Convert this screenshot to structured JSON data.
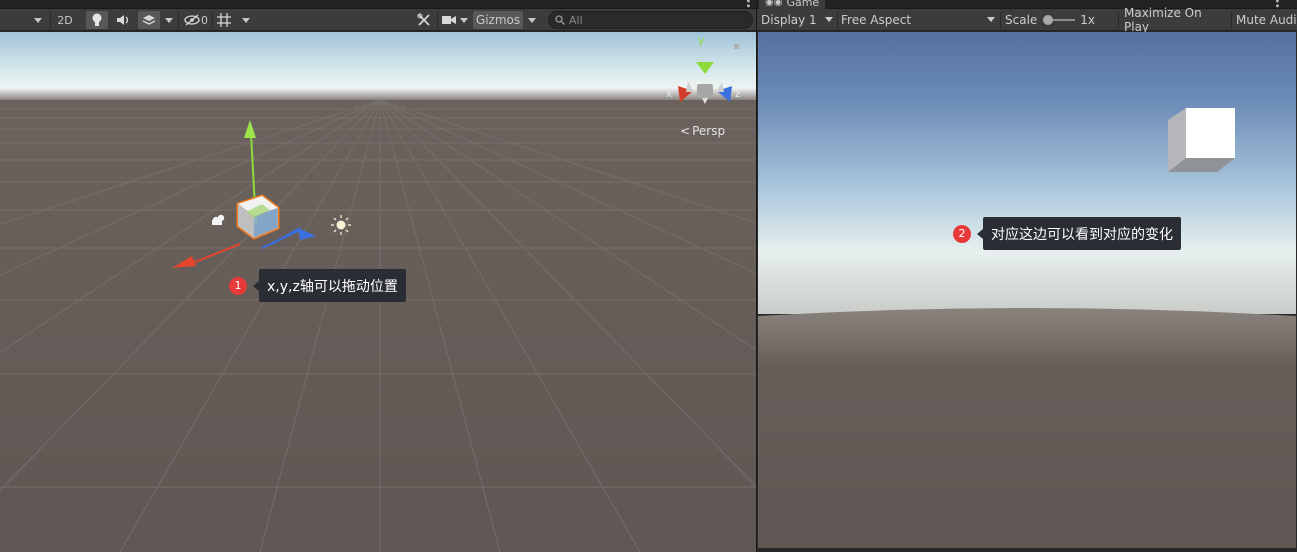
{
  "scene": {
    "toolbar": {
      "mode_2d": "2D",
      "hidden_count": "0",
      "gizmos": "Gizmos",
      "search_placeholder": "All"
    },
    "gizmo": {
      "axis_x": "x",
      "axis_y": "y",
      "axis_z": "z",
      "projection": "Persp"
    },
    "annotation": {
      "number": "1",
      "text": "x,y,z轴可以拖动位置"
    }
  },
  "game": {
    "tab_label": "Game",
    "toolbar": {
      "display": "Display 1",
      "aspect": "Free Aspect",
      "scale_label": "Scale",
      "scale_value": "1x",
      "maximize": "Maximize On Play",
      "mute": "Mute Audio"
    },
    "annotation": {
      "number": "2",
      "text": "对应这边可以看到对应的变化"
    }
  },
  "colors": {
    "toolbar_bg": "#3c3c3c",
    "ground": "#5f5753",
    "sky_game": "#5470a0",
    "annotation_badge": "#e8393a",
    "annotation_bubble": "#2a2d33",
    "axis_x": "#e5452a",
    "axis_y": "#8cdb3a",
    "axis_z": "#3a6fe0",
    "selection_outline": "#f47a1e"
  }
}
